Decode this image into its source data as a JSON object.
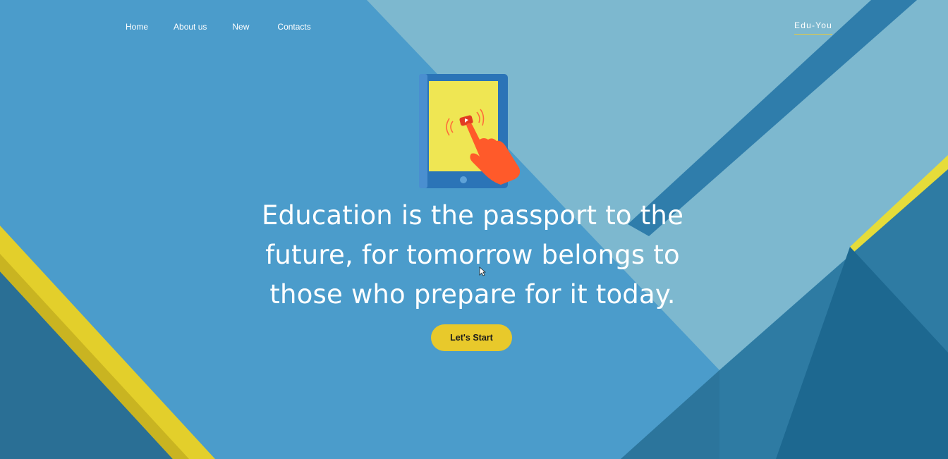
{
  "nav": {
    "items": [
      {
        "label": "Home"
      },
      {
        "label": "About us"
      },
      {
        "label": "New"
      },
      {
        "label": "Contacts"
      }
    ]
  },
  "brand": {
    "label": "Edu-You"
  },
  "hero": {
    "headline_lines": [
      "Education is the passport to the",
      "future, for tomorrow belongs to",
      "those who prepare for it today."
    ],
    "cta_label": "Let's Start",
    "illustration_icon": "tablet-tap-play-icon"
  },
  "colors": {
    "background_blue": "#4a9ccb",
    "light_panel": "#7ab8d3",
    "dark_strip": "#2f7fad",
    "accent_yellow": "#e8c92b",
    "tablet_screen": "#efe653",
    "hand_orange": "#ff5a2a"
  }
}
